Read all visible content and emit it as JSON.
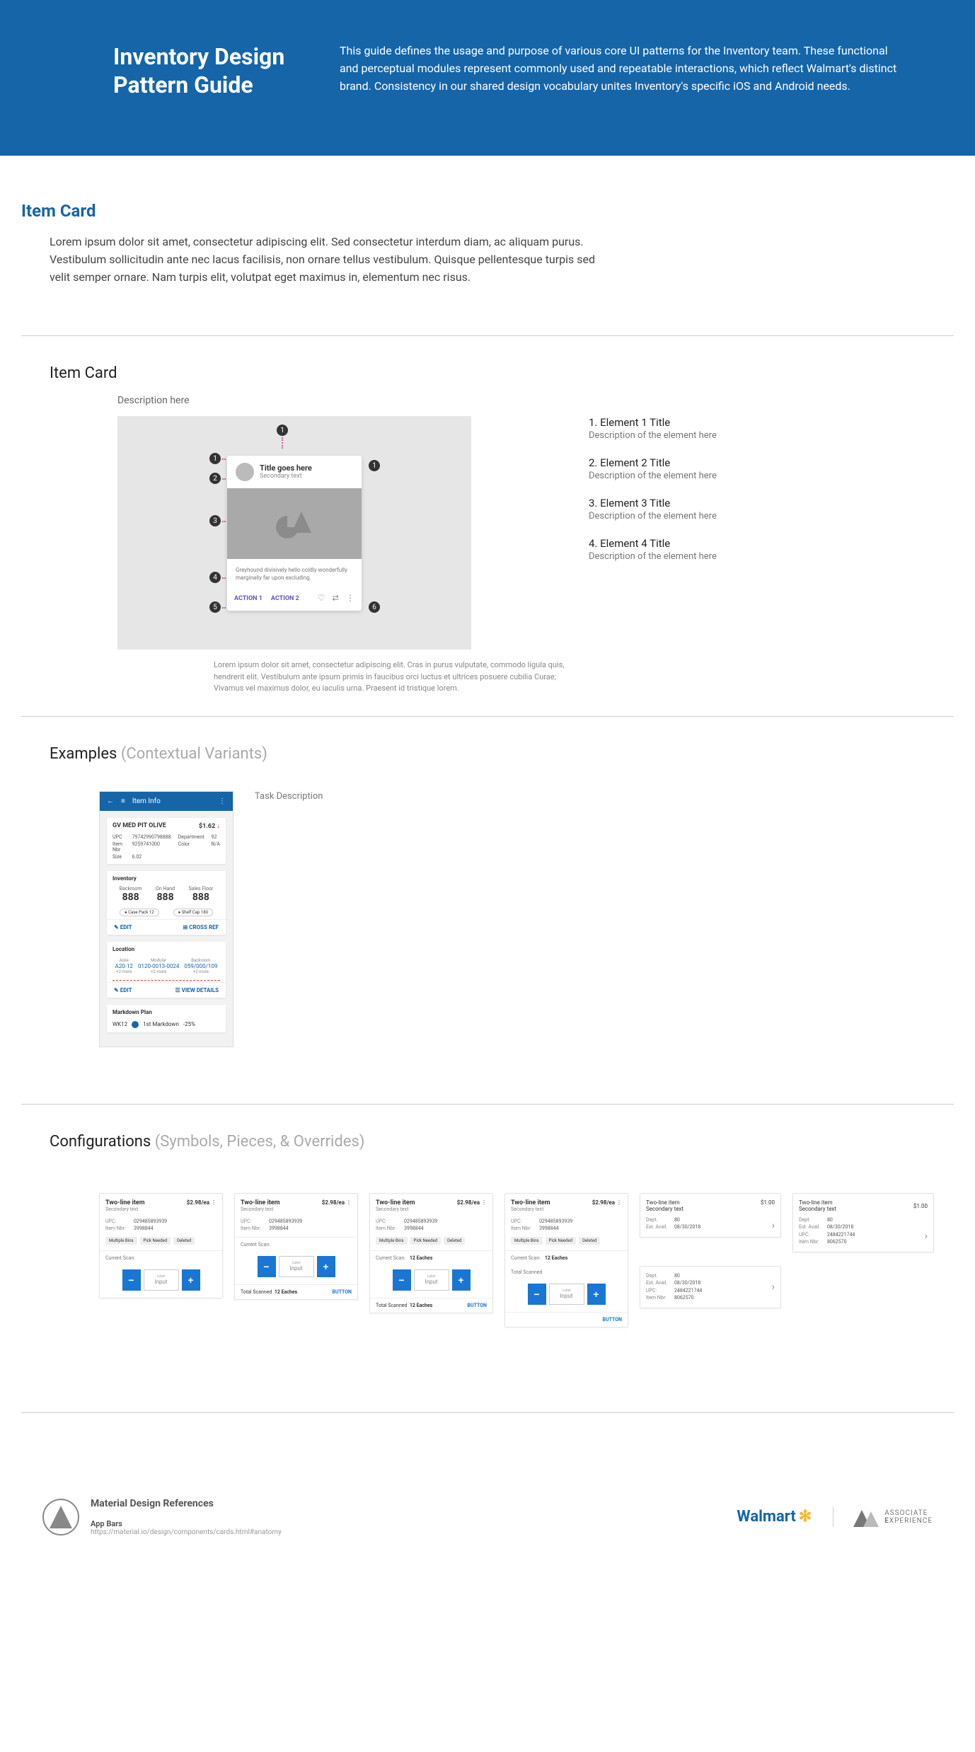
{
  "hero": {
    "title": "Inventory Design Pattern Guide",
    "desc": "This guide defines the usage and purpose of various core UI patterns for the Inventory team. These functional and perceptual modules represent commonly used and repeatable interactions, which reflect Walmart's distinct brand. Consistency in our shared design vocabulary unites Inventory's specific iOS and Android needs."
  },
  "section1": {
    "title": "Item Card",
    "intro": "Lorem ipsum dolor sit amet, consectetur adipiscing elit. Sed consectetur interdum diam, ac aliquam purus. Vestibulum sollicitudin ante nec lacus facilisis, non ornare tellus vestibulum. Quisque pellentesque turpis sed velit semper ornare. Nam turpis elit, volutpat eget maximus in, elementum nec risus."
  },
  "anatomy": {
    "title": "Item Card",
    "desc_here": "Description here",
    "mcard": {
      "title": "Title goes here",
      "secondary": "Secondary text",
      "body": "Greyhound divisively hello coldly wonderfully marginally far upon excluding.",
      "action1": "ACTION 1",
      "action2": "ACTION 2"
    },
    "elements": [
      {
        "num": "1.",
        "title": "Element 1 Title",
        "desc": "Description of the element here"
      },
      {
        "num": "2.",
        "title": "Element 2 Title",
        "desc": "Description of the element here"
      },
      {
        "num": "3.",
        "title": "Element 3 Title",
        "desc": "Description of the element here"
      },
      {
        "num": "4.",
        "title": "Element 4 Title",
        "desc": "Description of the element here"
      }
    ],
    "caption": "Lorem ipsum dolor sit amet, consectetur adipiscing elit. Cras in purus vulputate, commodo ligula quis, hendrerit elit. Vestibulum ante ipsum primis in faucibus orci luctus et ultrices posuere cubilia Curae; Vivamus vel maximus dolor, eu iaculis urna. Praesent id tristique lorem."
  },
  "examples": {
    "title": "Examples",
    "subtitle": "(Contextual Variants)",
    "task_desc": "Task Description",
    "phone": {
      "appbar_title": "Item Info",
      "item_name": "GV MED PIT OLIVE",
      "price": "$1.62",
      "price_icon": "↓",
      "upc_k": "UPC",
      "upc_v": "79742990798888",
      "itemnbr_k": "Item Nbr",
      "itemnbr_v": "9259741000",
      "dept_k": "Department",
      "dept_v": "92",
      "size_k": "Size",
      "size_v": "6.02",
      "color_k": "Color",
      "color_v": "N/A",
      "inventory_title": "Inventory",
      "inv": [
        {
          "label": "Backroom",
          "value": "888"
        },
        {
          "label": "On Hand",
          "value": "888"
        },
        {
          "label": "Sales Floor",
          "value": "888"
        }
      ],
      "pills": [
        {
          "icon": "●",
          "text": "Case Pack 12"
        },
        {
          "icon": "●",
          "text": "Shelf Cap 180"
        }
      ],
      "edit": "EDIT",
      "crossref": "CROSS REF",
      "location_title": "Location",
      "loc_heads": [
        "Aisle",
        "Modular",
        "Backroom"
      ],
      "locs": [
        {
          "value": "A20-12",
          "more": "+2 more"
        },
        {
          "value": "0120-0013-0024",
          "more": "+2 more"
        },
        {
          "value": "059/000/109",
          "more": "+2 more"
        }
      ],
      "viewdetails": "VIEW DETAILS",
      "markdown_title": "Markdown Plan",
      "md_week": "WK12",
      "md_text": "1st Markdown",
      "md_pct": "-25%"
    }
  },
  "configs": {
    "title": "Configurations",
    "subtitle": "(Symbols, Pieces, & Overrides)",
    "shared": {
      "name": "Two-line item",
      "secondary": "Secondary text",
      "price_ea": "$2.98/ea",
      "price": "$1.00",
      "upc_k": "UPC:",
      "upc_v": "029485893939",
      "itemnbr_k": "Item Nbr:",
      "itemnbr_v": "3998844",
      "dept_k": "Dept.",
      "dept_v": "80",
      "estavail_k": "Est. Avail.",
      "estavail_v": "08/30/2018",
      "upc2_v": "2484221744",
      "itemnbr2_v": "8062570",
      "chips": [
        "Multiple Bins",
        "Pick Needed",
        "Deleted"
      ],
      "current_scan": "Current Scan:",
      "scan_value": "12 Eaches",
      "label_lbl": "Label",
      "label_input": "Input",
      "minus": "−",
      "plus": "+",
      "total_scanned": "Total Scanned",
      "total_value": "12 Eaches",
      "button": "BUTTON",
      "chevron": "›"
    }
  },
  "footer": {
    "ref_title": "Material Design References",
    "ref_name": "App Bars",
    "ref_url": "https://material.io/design/components/cards.html#anatomy",
    "walmart": "Walmart",
    "assoc1": "ASSOCIATE",
    "assoc2": "EXPERIENCE"
  }
}
